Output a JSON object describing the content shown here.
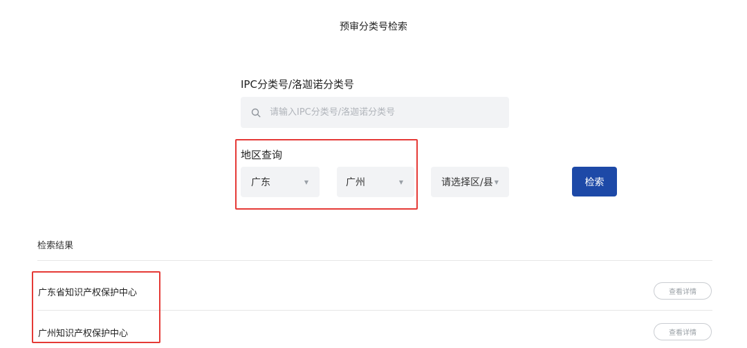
{
  "page": {
    "title": "预审分类号检索"
  },
  "ipc_search": {
    "label": "IPC分类号/洛迦诺分类号",
    "placeholder": "请输入IPC分类号/洛迦诺分类号",
    "value": "",
    "icon": "search-icon"
  },
  "region_query": {
    "label": "地区查询",
    "province": "广东",
    "city": "广州",
    "district": "请选择区/县",
    "caret_icon": "chevron-down-icon"
  },
  "search_button": {
    "label": "检索",
    "color": "#1d49a7"
  },
  "results": {
    "title": "检索结果",
    "items": [
      {
        "name": "广东省知识产权保护中心",
        "action": "查看详情"
      },
      {
        "name": "广州知识产权保护中心",
        "action": "查看详情"
      }
    ]
  },
  "annotations": {
    "highlight_color": "#e53935"
  }
}
